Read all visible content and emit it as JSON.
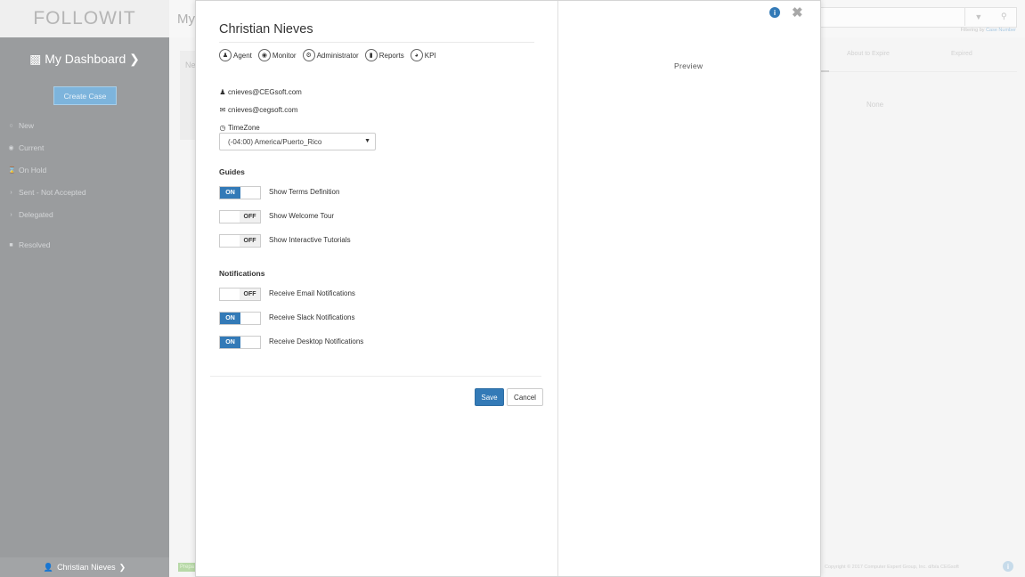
{
  "app": {
    "logo": "FOLLOWIT",
    "dashboard_title": "My Dashboard",
    "main_title": "My",
    "create_case": "Create Case",
    "nav": [
      {
        "label": "New",
        "icon": "circle-outline-icon"
      },
      {
        "label": "Current",
        "icon": "dot-circle-icon"
      },
      {
        "label": "On Hold",
        "icon": "hourglass-icon"
      },
      {
        "label": "Sent - Not Accepted",
        "icon": "chevron-right-icon"
      },
      {
        "label": "Delegated",
        "icon": "chevron-right-icon"
      },
      {
        "label": "Resolved",
        "icon": "square-icon"
      }
    ],
    "user_footer": "Christian Nieves",
    "filter_text_prefix": "Filtering by",
    "filter_text_link": "Case Number",
    "col_about_to_expire": "About to Expire",
    "col_expired": "Expired",
    "none_text": "None",
    "left_card_text": "Ne",
    "green_tag": "Prepa",
    "copyright": "Copyright © 2017 Computer Expert Group, Inc. d/b/a CEGsoft"
  },
  "modal": {
    "name": "Christian Nieves",
    "roles": [
      {
        "label": "Agent",
        "icon": "user-icon"
      },
      {
        "label": "Monitor",
        "icon": "eye-icon"
      },
      {
        "label": "Administrator",
        "icon": "gear-icon"
      },
      {
        "label": "Reports",
        "icon": "bar-chart-icon"
      },
      {
        "label": "KPI",
        "icon": "pie-chart-icon"
      }
    ],
    "username": "cnieves@CEGsoft.com",
    "email": "cnieves@cegsoft.com",
    "timezone_label": "TimeZone",
    "timezone_value": "(-04:00) America/Puerto_Rico",
    "guides_title": "Guides",
    "guides": [
      {
        "label": "Show Terms Definition",
        "state": "ON"
      },
      {
        "label": "Show Welcome Tour",
        "state": "OFF"
      },
      {
        "label": "Show Interactive Tutorials",
        "state": "OFF"
      }
    ],
    "notifications_title": "Notifications",
    "notifications": [
      {
        "label": "Receive Email Notifications",
        "state": "OFF"
      },
      {
        "label": "Receive Slack Notifications",
        "state": "ON"
      },
      {
        "label": "Receive Desktop Notifications",
        "state": "ON"
      }
    ],
    "save_label": "Save",
    "cancel_label": "Cancel",
    "preview_label": "Preview"
  },
  "colors": {
    "accent": "#337ab7",
    "sidebar": "#9a9c9e"
  }
}
